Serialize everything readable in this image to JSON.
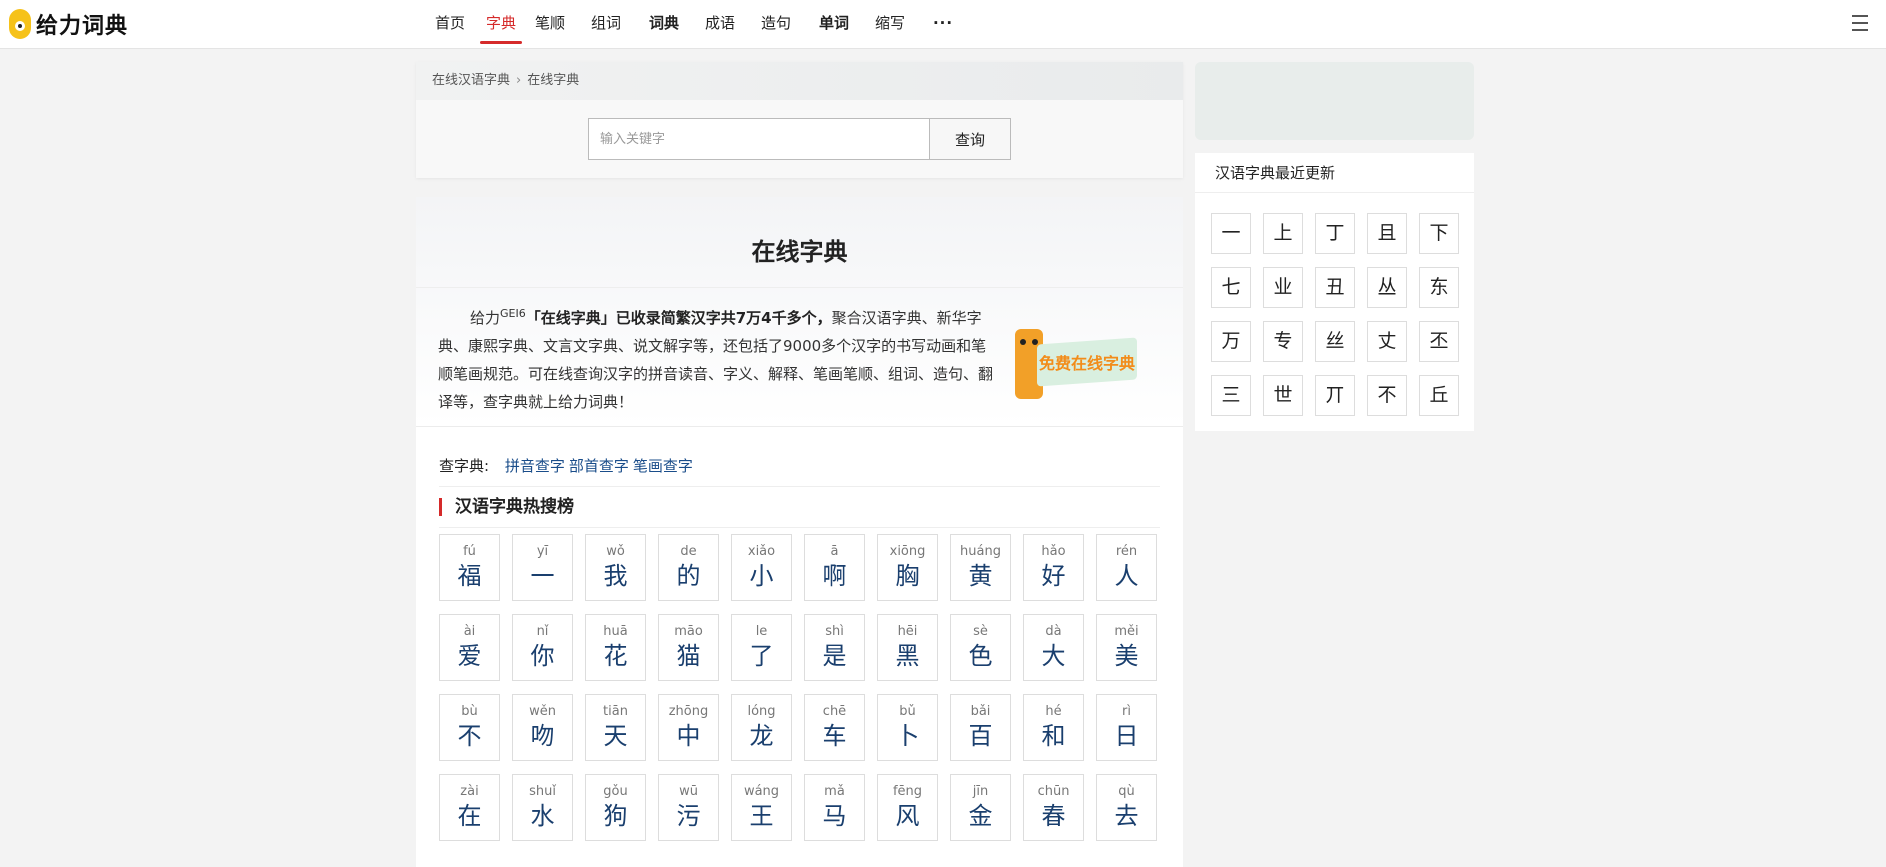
{
  "logo": {
    "text": "给力词典"
  },
  "nav": {
    "items": [
      {
        "label": "首页",
        "width": 60,
        "active": false,
        "bold": false
      },
      {
        "label": "字典",
        "width": 42,
        "active": true,
        "bold": false
      },
      {
        "label": "笔顺",
        "width": 56,
        "active": false,
        "bold": false
      },
      {
        "label": "组词",
        "width": 56,
        "active": false,
        "bold": false
      },
      {
        "label": "词典",
        "width": 60,
        "active": false,
        "bold": true
      },
      {
        "label": "成语",
        "width": 52,
        "active": false,
        "bold": false
      },
      {
        "label": "造句",
        "width": 60,
        "active": false,
        "bold": false
      },
      {
        "label": "单词",
        "width": 56,
        "active": false,
        "bold": true
      },
      {
        "label": "缩写",
        "width": 56,
        "active": false,
        "bold": false
      }
    ],
    "more": "···"
  },
  "breadcrumb": {
    "root": "在线汉语字典",
    "current": "在线字典"
  },
  "search": {
    "placeholder": "输入关键字",
    "button": "查询"
  },
  "intro": {
    "title": "在线字典",
    "brand": "给力",
    "sup": "GEI6",
    "bold": "「在线字典」已收录简繁汉字共7万4千多个，",
    "rest": "聚合汉语字典、新华字典、康熙字典、文言文字典、说文解字等，还包括了9000多个汉字的书写动画和笔顺笔画规范。可在线查询汉字的拼音读音、字义、解释、笔画笔顺、组词、造句、翻译等，查字典就上给力词典！",
    "promo": "免费在线字典"
  },
  "lookup": {
    "label": "查字典:",
    "links": [
      "拼音查字",
      "部首查字",
      "笔画查字"
    ]
  },
  "hot": {
    "title": "汉语字典热搜榜",
    "chars": [
      {
        "py": "fú",
        "hz": "福"
      },
      {
        "py": "yī",
        "hz": "一"
      },
      {
        "py": "wǒ",
        "hz": "我"
      },
      {
        "py": "de",
        "hz": "的"
      },
      {
        "py": "xiǎo",
        "hz": "小"
      },
      {
        "py": "ā",
        "hz": "啊"
      },
      {
        "py": "xiōng",
        "hz": "胸"
      },
      {
        "py": "huáng",
        "hz": "黄"
      },
      {
        "py": "hǎo",
        "hz": "好"
      },
      {
        "py": "rén",
        "hz": "人"
      },
      {
        "py": "ài",
        "hz": "爱"
      },
      {
        "py": "nǐ",
        "hz": "你"
      },
      {
        "py": "huā",
        "hz": "花"
      },
      {
        "py": "māo",
        "hz": "猫"
      },
      {
        "py": "le",
        "hz": "了"
      },
      {
        "py": "shì",
        "hz": "是"
      },
      {
        "py": "hēi",
        "hz": "黑"
      },
      {
        "py": "sè",
        "hz": "色"
      },
      {
        "py": "dà",
        "hz": "大"
      },
      {
        "py": "měi",
        "hz": "美"
      },
      {
        "py": "bù",
        "hz": "不"
      },
      {
        "py": "wěn",
        "hz": "吻"
      },
      {
        "py": "tiān",
        "hz": "天"
      },
      {
        "py": "zhōng",
        "hz": "中"
      },
      {
        "py": "lóng",
        "hz": "龙"
      },
      {
        "py": "chē",
        "hz": "车"
      },
      {
        "py": "bǔ",
        "hz": "卜"
      },
      {
        "py": "bǎi",
        "hz": "百"
      },
      {
        "py": "hé",
        "hz": "和"
      },
      {
        "py": "rì",
        "hz": "日"
      },
      {
        "py": "zài",
        "hz": "在"
      },
      {
        "py": "shuǐ",
        "hz": "水"
      },
      {
        "py": "gǒu",
        "hz": "狗"
      },
      {
        "py": "wū",
        "hz": "污"
      },
      {
        "py": "wáng",
        "hz": "王"
      },
      {
        "py": "mǎ",
        "hz": "马"
      },
      {
        "py": "fēng",
        "hz": "风"
      },
      {
        "py": "jīn",
        "hz": "金"
      },
      {
        "py": "chūn",
        "hz": "春"
      },
      {
        "py": "qù",
        "hz": "去"
      }
    ]
  },
  "recent": {
    "title": "汉语字典最近更新",
    "chars": [
      "一",
      "上",
      "丁",
      "且",
      "下",
      "七",
      "业",
      "丑",
      "丛",
      "东",
      "万",
      "专",
      "丝",
      "丈",
      "丕",
      "三",
      "世",
      "丌",
      "不",
      "丘"
    ]
  }
}
